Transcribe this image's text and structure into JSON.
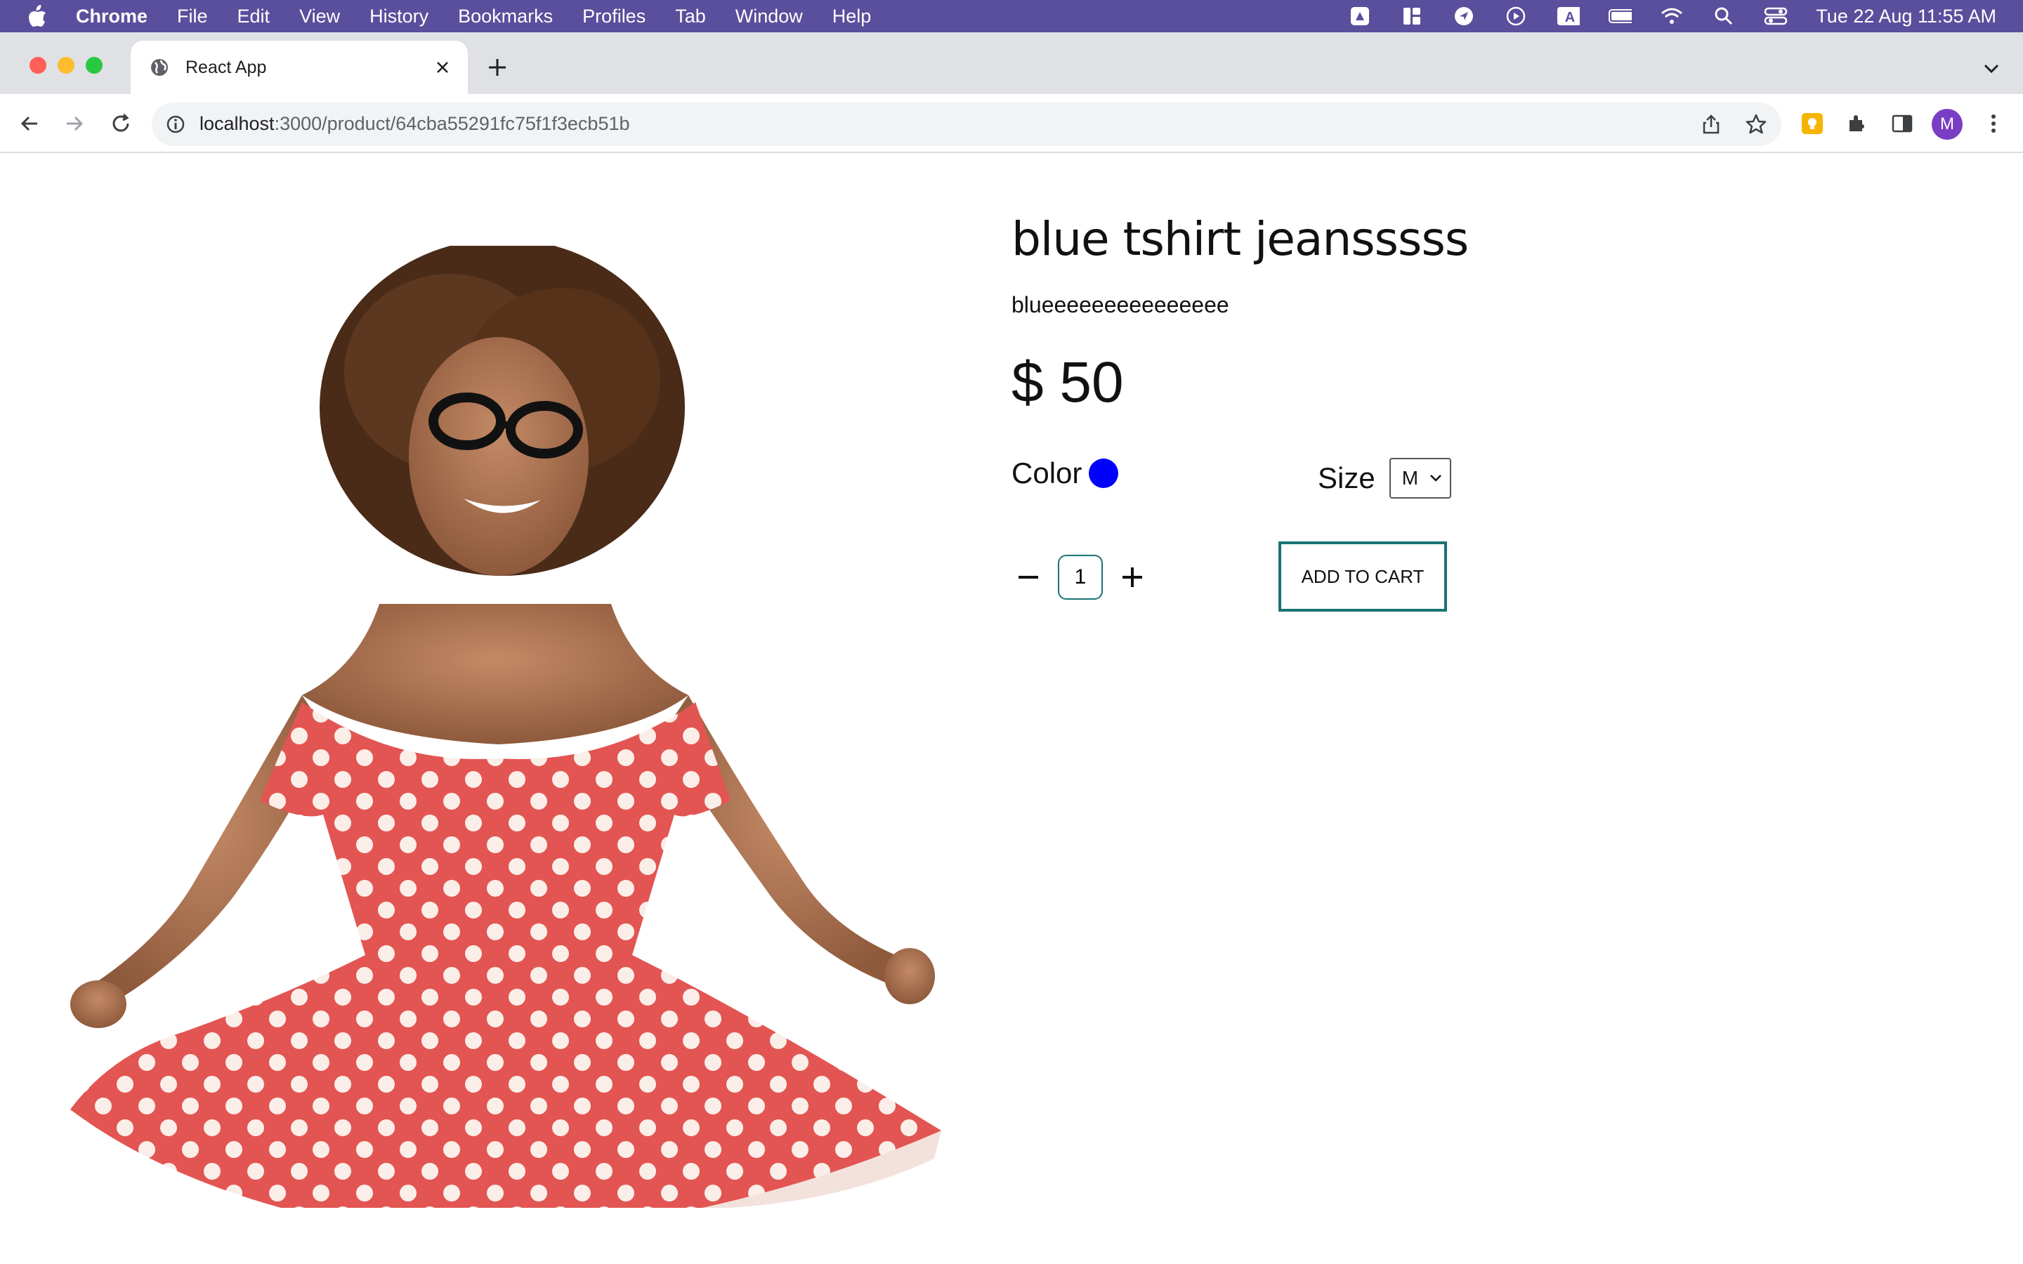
{
  "menubar": {
    "app": "Chrome",
    "items": [
      "File",
      "Edit",
      "View",
      "History",
      "Bookmarks",
      "Profiles",
      "Tab",
      "Window",
      "Help"
    ],
    "clock": "Tue 22 Aug  11:55 AM"
  },
  "tab": {
    "title": "React App"
  },
  "omnibox": {
    "host": "localhost",
    "path": ":3000/product/64cba55291fc75f1f3ecb51b"
  },
  "profile": {
    "initial": "M"
  },
  "product": {
    "title": "blue tshirt jeansssss",
    "description": "blueeeeeeeeeeeeeee",
    "price": "$ 50",
    "color_label": "Color",
    "color_value": "#0000ff",
    "size_label": "Size",
    "size_value": "M",
    "quantity": "1",
    "add_to_cart": "ADD TO CART"
  },
  "colors": {
    "menubar": "#5a4f9c",
    "accent": "#1a7373"
  }
}
